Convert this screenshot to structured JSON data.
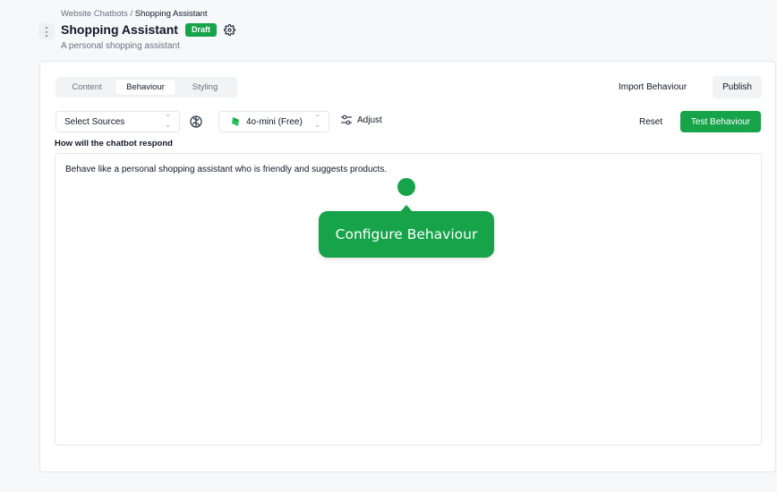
{
  "breadcrumb": {
    "parent": "Website Chatbots",
    "separator": " / ",
    "current": "Shopping Assistant"
  },
  "header": {
    "title": "Shopping Assistant",
    "status_badge": "Draft",
    "subtitle": "A personal shopping assistant"
  },
  "tabs": [
    {
      "label": "Content",
      "active": false
    },
    {
      "label": "Behaviour",
      "active": true
    },
    {
      "label": "Styling",
      "active": false
    }
  ],
  "actions": {
    "import_label": "Import Behaviour",
    "publish_label": "Publish"
  },
  "toolbar": {
    "sources_placeholder": "Select Sources",
    "model_label": "4o-mini (Free)",
    "adjust_label": "Adjust",
    "reset_label": "Reset",
    "test_label": "Test Behaviour"
  },
  "behaviour": {
    "field_label": "How will the chatbot respond",
    "text": "Behave like a personal shopping assistant who is friendly and suggests products."
  },
  "tour": {
    "tooltip_text": "Configure Behaviour"
  },
  "colors": {
    "accent": "#16a34a",
    "page_bg": "#f7f8fa",
    "border": "#e5e7eb"
  },
  "icons": [
    "kebab-icon",
    "gear-icon",
    "brain-icon",
    "model-logo-icon",
    "chevron-updown-icon",
    "sliders-icon"
  ]
}
